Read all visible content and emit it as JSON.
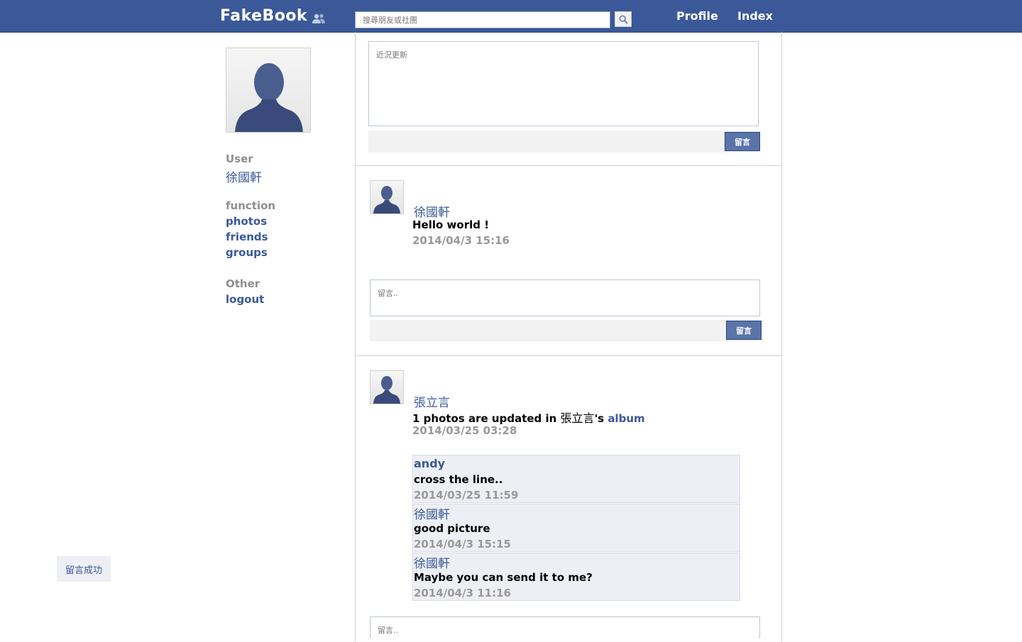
{
  "header": {
    "logo": "FakeBook",
    "search_placeholder": "搜尋朋友或社團",
    "nav": [
      "Profile",
      "Index"
    ]
  },
  "sidebar": {
    "user_heading": "User",
    "user_name": "徐國軒",
    "function_heading": "function",
    "function_links": [
      "photos",
      "friends",
      "groups"
    ],
    "other_heading": "Other",
    "logout": "logout"
  },
  "composer": {
    "placeholder": "近況更新",
    "submit_label": "留言"
  },
  "posts": [
    {
      "author": "徐國軒",
      "text": "Hello world !",
      "time": "2014/04/3 15:16",
      "comment_placeholder": "留言..",
      "comment_button": "留言"
    },
    {
      "author": "張立言",
      "text_prefix": "1 photos are updated in ",
      "text_owner": "張立言",
      "text_possessive": "'s ",
      "text_link": "album",
      "time": "2014/03/25 03:28",
      "comments": [
        {
          "author": "andy",
          "text": "cross the line..",
          "time": "2014/03/25 11:59"
        },
        {
          "author": "徐國軒",
          "text": "good picture",
          "time": "2014/04/3 15:15"
        },
        {
          "author": "徐國軒",
          "text": "Maybe you can send it to me?",
          "time": "2014/04/3 11:16"
        }
      ],
      "comment_placeholder": "留言.."
    }
  ],
  "toast": "留言成功",
  "colors": {
    "brand": "#3b5998",
    "button": "#5b74a8",
    "comment_bg": "#edeff4",
    "muted": "#999999"
  },
  "icons": [
    "friends-icon",
    "search-icon",
    "default-avatar-icon"
  ]
}
